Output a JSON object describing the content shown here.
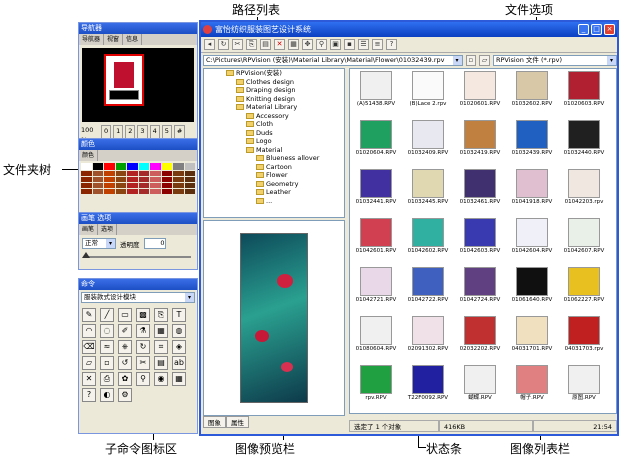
{
  "annotations": {
    "path_list": "路径列表",
    "file_options": "文件选项",
    "folder_tree": "文件夹树",
    "sub_command_icons": "子命令图标区",
    "image_preview": "图像预览栏",
    "status_bar": "状态条",
    "image_list": "图像列表栏"
  },
  "navigator": {
    "title": "导航器",
    "tabs": [
      "导航器",
      "视窗",
      "信息"
    ],
    "zoom_row": [
      "100 %",
      "0",
      "1",
      "2",
      "3",
      "4",
      "5",
      "#"
    ]
  },
  "colors_panel": {
    "title": "颜色",
    "tab": "颜色",
    "swatches_row1": [
      "#ffffff",
      "#000000",
      "#ff0000",
      "#00a000",
      "#0000ff",
      "#00ffff",
      "#ff00ff",
      "#ffff00",
      "#808080",
      "#c0c0c0"
    ],
    "swatches_rows": [
      "#8b2500",
      "#a0522d",
      "#c04000",
      "#8b4513",
      "#b22222",
      "#a52a2a",
      "#cd5c5c",
      "#8b0000",
      "#7a3a10",
      "#5c2e0e"
    ]
  },
  "brush_panel": {
    "title": "画笔 选项",
    "tabs": [
      "画笔",
      "选项"
    ],
    "mode_value": "正常",
    "opacity_label": "透明度",
    "opacity_value": "0"
  },
  "command_panel": {
    "title": "命令",
    "select_value": "服装款式设计模块",
    "icons": [
      "pencil-icon",
      "line-icon",
      "rect-icon",
      "fill-icon",
      "copy-icon",
      "text-icon",
      "curve-icon",
      "lasso-icon",
      "brush-icon",
      "dropper-icon",
      "pattern-icon",
      "color-wheel-icon",
      "eraser-icon",
      "smudge-icon",
      "stamp-icon",
      "rotate-icon",
      "crop-icon",
      "bucket-icon",
      "open-icon",
      "save-icon",
      "refresh-icon",
      "scissors-icon",
      "document-icon",
      "ab-icon",
      "delete-icon",
      "print-icon",
      "flower-icon",
      "zoom-icon",
      "view-icon",
      "grid-icon",
      "help-icon",
      "bear-icon",
      "settings-icon"
    ]
  },
  "window": {
    "title": "富怡纺织服装图艺设计系统",
    "buttons": [
      "_",
      "□",
      "×"
    ],
    "path_value": "C:\\Pictures\\RPVision (安装)\\Material Library\\Material\\Flower\\01032439.rpv",
    "file_type_value": "RPVision 文件 (*.rpv)",
    "preview_tabs": [
      "图象",
      "属性"
    ]
  },
  "tree": [
    {
      "indent": 0,
      "label": "RPVision(安装)"
    },
    {
      "indent": 1,
      "label": "Clothes design"
    },
    {
      "indent": 1,
      "label": "Draping design"
    },
    {
      "indent": 1,
      "label": "Knitting design"
    },
    {
      "indent": 1,
      "label": "Material Library"
    },
    {
      "indent": 2,
      "label": "Accessory"
    },
    {
      "indent": 2,
      "label": "Cloth"
    },
    {
      "indent": 2,
      "label": "Duds"
    },
    {
      "indent": 2,
      "label": "Logo"
    },
    {
      "indent": 2,
      "label": "Material"
    },
    {
      "indent": 3,
      "label": "Blueness allover"
    },
    {
      "indent": 3,
      "label": "Cartoon"
    },
    {
      "indent": 3,
      "label": "Flower"
    },
    {
      "indent": 3,
      "label": "Geometry"
    },
    {
      "indent": 3,
      "label": "Leather"
    },
    {
      "indent": 3,
      "label": "..."
    }
  ],
  "thumbs": [
    {
      "label": "(A)51438.RPV",
      "color": "#f0f0f0"
    },
    {
      "label": "(B)Lace 2.rpv",
      "color": "#fafafa"
    },
    {
      "label": "01020601.RPV",
      "color": "#f4e8e0"
    },
    {
      "label": "01032602.RPV",
      "color": "#d8c8a8"
    },
    {
      "label": "01020603.RPV",
      "color": "#b02030"
    },
    {
      "label": "01020604.RPV",
      "color": "#20a060"
    },
    {
      "label": "01032409.RPV",
      "color": "#e8e8f0"
    },
    {
      "label": "01032419.RPV",
      "color": "#c08040"
    },
    {
      "label": "01032439.RPV",
      "color": "#2060c0"
    },
    {
      "label": "01032440.RPV",
      "color": "#202020"
    },
    {
      "label": "01032441.RPV",
      "color": "#4030a0"
    },
    {
      "label": "01032445.RPV",
      "color": "#e0d8b0"
    },
    {
      "label": "01032461.RPV",
      "color": "#403070"
    },
    {
      "label": "01041918.RPV",
      "color": "#e0c0d0"
    },
    {
      "label": "01042203.rpv",
      "color": "#f0e8e0"
    },
    {
      "label": "01042601.RPV",
      "color": "#d04050"
    },
    {
      "label": "01042602.RPV",
      "color": "#30b0a0"
    },
    {
      "label": "01042603.RPV",
      "color": "#3a3ab0"
    },
    {
      "label": "01042604.RPV",
      "color": "#f0f0f8"
    },
    {
      "label": "01042607.RPV",
      "color": "#e8f0e8"
    },
    {
      "label": "01042721.RPV",
      "color": "#e8d8e8"
    },
    {
      "label": "01042722.RPV",
      "color": "#4060c0"
    },
    {
      "label": "01042724.RPV",
      "color": "#604080"
    },
    {
      "label": "01061640.RPV",
      "color": "#101010"
    },
    {
      "label": "01062227.RPV",
      "color": "#e8c020"
    },
    {
      "label": "01080604.RPV",
      "color": "#f0f0f0"
    },
    {
      "label": "02091302.RPV",
      "color": "#f0e0e8"
    },
    {
      "label": "02032202.RPV",
      "color": "#c03030"
    },
    {
      "label": "04031701.RPV",
      "color": "#f0e0c0"
    },
    {
      "label": "04031703.rpv",
      "color": "#c02020"
    },
    {
      "label": "rpv.RPV",
      "color": "#20a040"
    },
    {
      "label": "T22F0092.RPV",
      "color": "#2020a0"
    },
    {
      "label": "蝴蝶.RPV",
      "color": "#f0f0f0"
    },
    {
      "label": "帽子.RPV",
      "color": "#e08080"
    },
    {
      "label": "原图.RPV",
      "color": "#f0f0f0"
    }
  ],
  "status": {
    "selected": "选定了 1 个对象",
    "size": "416KB",
    "time": "21:54"
  }
}
